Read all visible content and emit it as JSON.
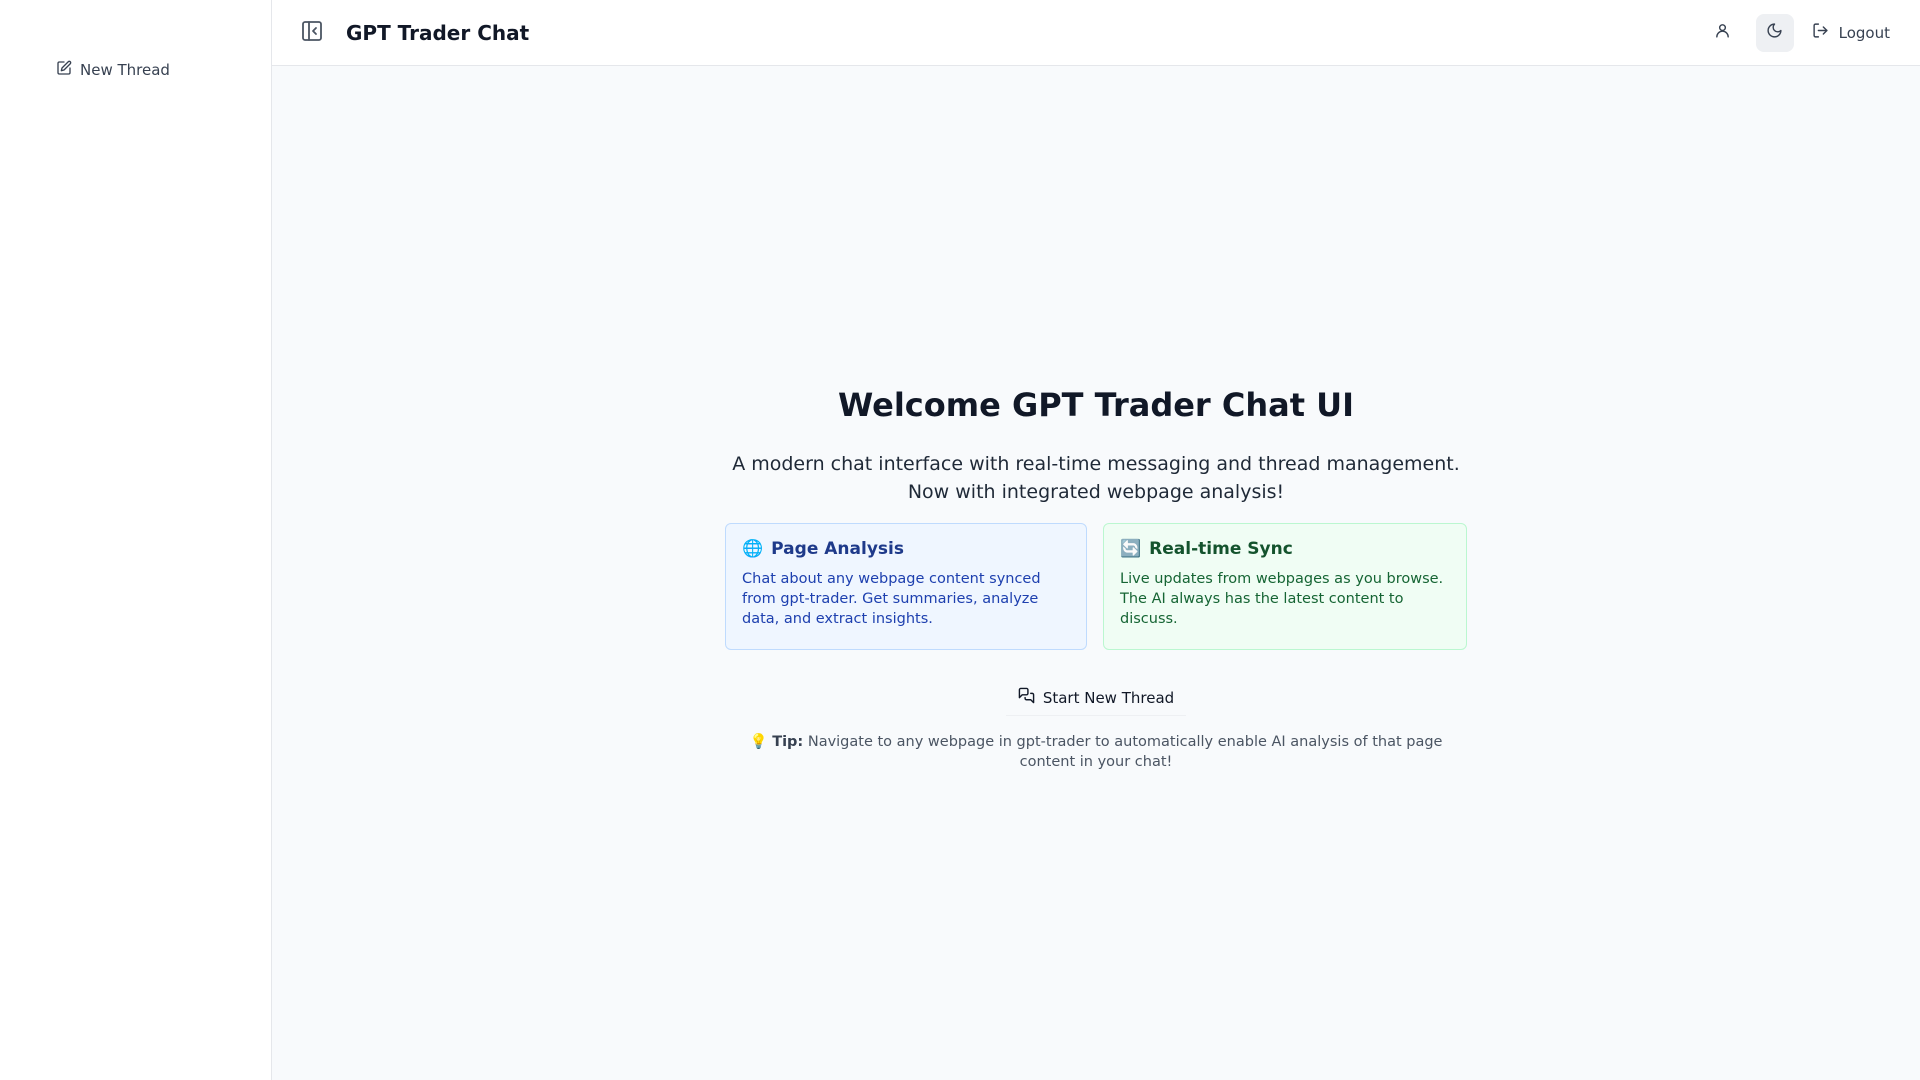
{
  "sidebar": {
    "new_thread_label": "New Thread"
  },
  "header": {
    "title": "GPT Trader Chat",
    "logout_label": "Logout"
  },
  "welcome": {
    "title": "Welcome GPT Trader Chat UI",
    "subtitle": "A modern chat interface with real-time messaging and thread management. Now with integrated webpage analysis!",
    "cards": [
      {
        "emoji": "🌐",
        "title": "Page Analysis",
        "text": "Chat about any webpage content synced from gpt-trader. Get summaries, analyze data, and extract insights."
      },
      {
        "emoji": "🔄",
        "title": "Real-time Sync",
        "text": "Live updates from webpages as you browse. The AI always has the latest content to discuss."
      }
    ],
    "start_button_label": "Start New Thread",
    "tip_emoji": "💡",
    "tip_label": "Tip:",
    "tip_text": "Navigate to any webpage in gpt-trader to automatically enable AI analysis of that page content in your chat!"
  },
  "icons": {
    "new_thread": "pencil-square-icon",
    "toggle_sidebar": "panel-left-close-icon",
    "user": "user-icon",
    "theme": "moon-icon",
    "logout": "logout-icon",
    "start_thread": "messages-icon"
  }
}
